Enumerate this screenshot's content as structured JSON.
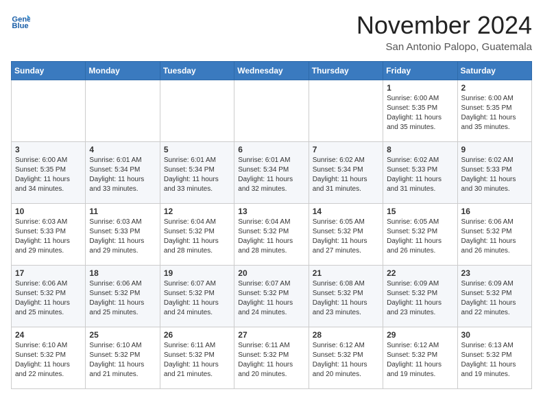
{
  "header": {
    "logo_line1": "General",
    "logo_line2": "Blue",
    "month_title": "November 2024",
    "location": "San Antonio Palopo, Guatemala"
  },
  "weekdays": [
    "Sunday",
    "Monday",
    "Tuesday",
    "Wednesday",
    "Thursday",
    "Friday",
    "Saturday"
  ],
  "weeks": [
    [
      {
        "day": "",
        "info": ""
      },
      {
        "day": "",
        "info": ""
      },
      {
        "day": "",
        "info": ""
      },
      {
        "day": "",
        "info": ""
      },
      {
        "day": "",
        "info": ""
      },
      {
        "day": "1",
        "info": "Sunrise: 6:00 AM\nSunset: 5:35 PM\nDaylight: 11 hours\nand 35 minutes."
      },
      {
        "day": "2",
        "info": "Sunrise: 6:00 AM\nSunset: 5:35 PM\nDaylight: 11 hours\nand 35 minutes."
      }
    ],
    [
      {
        "day": "3",
        "info": "Sunrise: 6:00 AM\nSunset: 5:35 PM\nDaylight: 11 hours\nand 34 minutes."
      },
      {
        "day": "4",
        "info": "Sunrise: 6:01 AM\nSunset: 5:34 PM\nDaylight: 11 hours\nand 33 minutes."
      },
      {
        "day": "5",
        "info": "Sunrise: 6:01 AM\nSunset: 5:34 PM\nDaylight: 11 hours\nand 33 minutes."
      },
      {
        "day": "6",
        "info": "Sunrise: 6:01 AM\nSunset: 5:34 PM\nDaylight: 11 hours\nand 32 minutes."
      },
      {
        "day": "7",
        "info": "Sunrise: 6:02 AM\nSunset: 5:34 PM\nDaylight: 11 hours\nand 31 minutes."
      },
      {
        "day": "8",
        "info": "Sunrise: 6:02 AM\nSunset: 5:33 PM\nDaylight: 11 hours\nand 31 minutes."
      },
      {
        "day": "9",
        "info": "Sunrise: 6:02 AM\nSunset: 5:33 PM\nDaylight: 11 hours\nand 30 minutes."
      }
    ],
    [
      {
        "day": "10",
        "info": "Sunrise: 6:03 AM\nSunset: 5:33 PM\nDaylight: 11 hours\nand 29 minutes."
      },
      {
        "day": "11",
        "info": "Sunrise: 6:03 AM\nSunset: 5:33 PM\nDaylight: 11 hours\nand 29 minutes."
      },
      {
        "day": "12",
        "info": "Sunrise: 6:04 AM\nSunset: 5:32 PM\nDaylight: 11 hours\nand 28 minutes."
      },
      {
        "day": "13",
        "info": "Sunrise: 6:04 AM\nSunset: 5:32 PM\nDaylight: 11 hours\nand 28 minutes."
      },
      {
        "day": "14",
        "info": "Sunrise: 6:05 AM\nSunset: 5:32 PM\nDaylight: 11 hours\nand 27 minutes."
      },
      {
        "day": "15",
        "info": "Sunrise: 6:05 AM\nSunset: 5:32 PM\nDaylight: 11 hours\nand 26 minutes."
      },
      {
        "day": "16",
        "info": "Sunrise: 6:06 AM\nSunset: 5:32 PM\nDaylight: 11 hours\nand 26 minutes."
      }
    ],
    [
      {
        "day": "17",
        "info": "Sunrise: 6:06 AM\nSunset: 5:32 PM\nDaylight: 11 hours\nand 25 minutes."
      },
      {
        "day": "18",
        "info": "Sunrise: 6:06 AM\nSunset: 5:32 PM\nDaylight: 11 hours\nand 25 minutes."
      },
      {
        "day": "19",
        "info": "Sunrise: 6:07 AM\nSunset: 5:32 PM\nDaylight: 11 hours\nand 24 minutes."
      },
      {
        "day": "20",
        "info": "Sunrise: 6:07 AM\nSunset: 5:32 PM\nDaylight: 11 hours\nand 24 minutes."
      },
      {
        "day": "21",
        "info": "Sunrise: 6:08 AM\nSunset: 5:32 PM\nDaylight: 11 hours\nand 23 minutes."
      },
      {
        "day": "22",
        "info": "Sunrise: 6:09 AM\nSunset: 5:32 PM\nDaylight: 11 hours\nand 23 minutes."
      },
      {
        "day": "23",
        "info": "Sunrise: 6:09 AM\nSunset: 5:32 PM\nDaylight: 11 hours\nand 22 minutes."
      }
    ],
    [
      {
        "day": "24",
        "info": "Sunrise: 6:10 AM\nSunset: 5:32 PM\nDaylight: 11 hours\nand 22 minutes."
      },
      {
        "day": "25",
        "info": "Sunrise: 6:10 AM\nSunset: 5:32 PM\nDaylight: 11 hours\nand 21 minutes."
      },
      {
        "day": "26",
        "info": "Sunrise: 6:11 AM\nSunset: 5:32 PM\nDaylight: 11 hours\nand 21 minutes."
      },
      {
        "day": "27",
        "info": "Sunrise: 6:11 AM\nSunset: 5:32 PM\nDaylight: 11 hours\nand 20 minutes."
      },
      {
        "day": "28",
        "info": "Sunrise: 6:12 AM\nSunset: 5:32 PM\nDaylight: 11 hours\nand 20 minutes."
      },
      {
        "day": "29",
        "info": "Sunrise: 6:12 AM\nSunset: 5:32 PM\nDaylight: 11 hours\nand 19 minutes."
      },
      {
        "day": "30",
        "info": "Sunrise: 6:13 AM\nSunset: 5:32 PM\nDaylight: 11 hours\nand 19 minutes."
      }
    ]
  ]
}
